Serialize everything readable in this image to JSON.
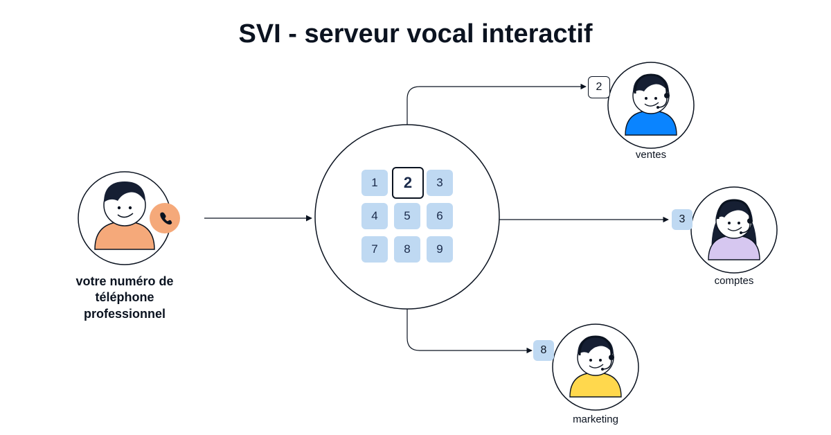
{
  "title": "SVI - serveur vocal interactif",
  "caller": {
    "label": "votre numéro de téléphone professionnel",
    "shirt_color": "#f5a97a"
  },
  "keypad": {
    "keys": [
      "1",
      "2",
      "3",
      "4",
      "5",
      "6",
      "7",
      "8",
      "9"
    ],
    "selected_index": 1,
    "key_color": "#bfd9f2"
  },
  "routes": [
    {
      "key": "2",
      "label": "ventes",
      "box_style": "white",
      "shirt_color": "#0a84ff",
      "hair": "short"
    },
    {
      "key": "3",
      "label": "comptes",
      "box_style": "blue",
      "shirt_color": "#d6c7f0",
      "hair": "long"
    },
    {
      "key": "8",
      "label": "marketing",
      "box_style": "blue",
      "shirt_color": "#ffd84d",
      "hair": "short"
    }
  ],
  "colors": {
    "hair": "#161f33",
    "face": "#ffffff",
    "stroke": "#0b1320"
  }
}
